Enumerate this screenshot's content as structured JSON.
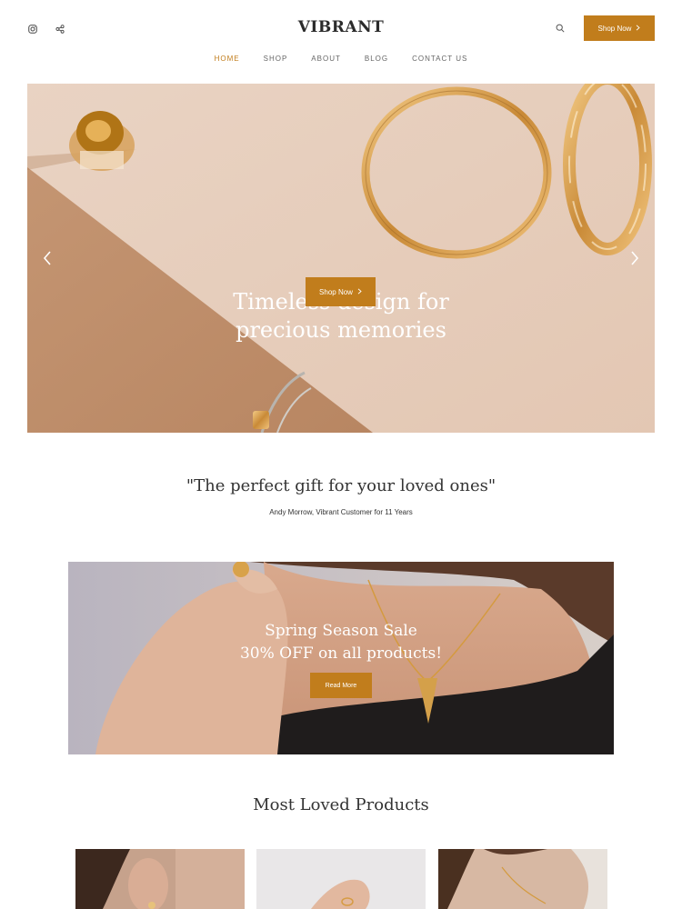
{
  "brand": {
    "name": "VIBRANT",
    "accent": "#c17d1c"
  },
  "header": {
    "social_icons": [
      "instagram-icon",
      "share-icon"
    ],
    "search_icon": "search-icon",
    "cta_label": "Shop Now"
  },
  "nav": {
    "items": [
      {
        "label": "HOME",
        "active": true
      },
      {
        "label": "SHOP",
        "active": false
      },
      {
        "label": "ABOUT",
        "active": false
      },
      {
        "label": "BLOG",
        "active": false
      },
      {
        "label": "CONTACT US",
        "active": false
      }
    ]
  },
  "hero": {
    "title": "Timeless design for precious memories",
    "cta_label": "Shop Now",
    "prev_icon": "chevron-left-icon",
    "next_icon": "chevron-right-icon"
  },
  "testimonial": {
    "quote": "\"The perfect gift for your loved ones\"",
    "author": "Andy Morrow, Vibrant Customer for 11 Years"
  },
  "sale": {
    "title_line1": "Spring Season Sale",
    "title_line2": "30% OFF on all products!",
    "cta_label": "Read More"
  },
  "products": {
    "title": "Most Loved Products",
    "items": [
      {
        "image": "earring-product-photo"
      },
      {
        "image": "ring-product-photo"
      },
      {
        "image": "necklace-product-photo"
      }
    ]
  }
}
